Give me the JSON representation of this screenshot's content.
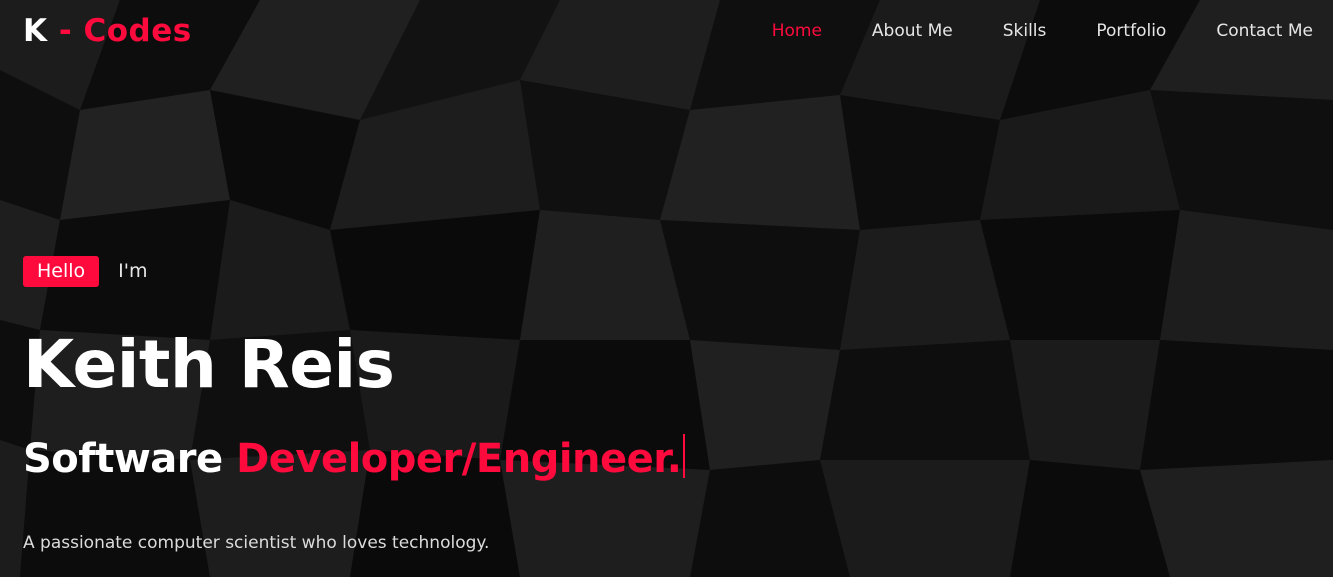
{
  "brand": {
    "prefix": "K",
    "suffix": "- Codes"
  },
  "nav": {
    "items": [
      {
        "label": "Home",
        "active": true
      },
      {
        "label": "About Me",
        "active": false
      },
      {
        "label": "Skills",
        "active": false
      },
      {
        "label": "Portfolio",
        "active": false
      },
      {
        "label": "Contact Me",
        "active": false
      }
    ]
  },
  "hero": {
    "badge": "Hello",
    "intro": "I'm",
    "name": "Keith Reis",
    "role_prefix": "Software",
    "role_highlight": "Developer/Engineer.",
    "tagline": "A passionate computer scientist who loves technology."
  },
  "colors": {
    "accent": "#ff0a3d",
    "background": "#111111",
    "text": "#ffffff"
  }
}
